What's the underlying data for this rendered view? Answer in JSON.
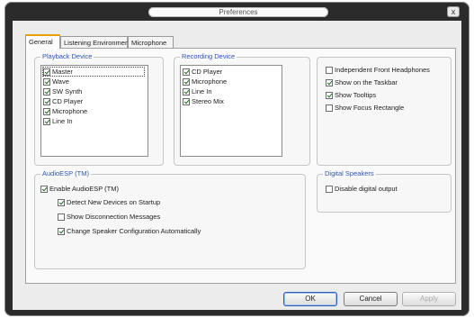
{
  "window": {
    "title": "Preferences",
    "close_glyph": "x"
  },
  "tabs": [
    {
      "label": "General",
      "active": true
    },
    {
      "label": "Listening Environment",
      "active": false
    },
    {
      "label": "Microphone",
      "active": false
    }
  ],
  "playback": {
    "title": "Playback Device",
    "items": [
      {
        "label": "Master",
        "checked": true
      },
      {
        "label": "Wave",
        "checked": true
      },
      {
        "label": "SW Synth",
        "checked": true
      },
      {
        "label": "CD Player",
        "checked": true
      },
      {
        "label": "Microphone",
        "checked": true
      },
      {
        "label": "Line In",
        "checked": true
      }
    ]
  },
  "recording": {
    "title": "Recording Device",
    "items": [
      {
        "label": "CD Player",
        "checked": true
      },
      {
        "label": "Microphone",
        "checked": true
      },
      {
        "label": "Line In",
        "checked": true
      },
      {
        "label": "Stereo Mix",
        "checked": true
      }
    ]
  },
  "options": [
    {
      "label": "Independent Front Headphones",
      "checked": false
    },
    {
      "label": "Show on the Taskbar",
      "checked": true
    },
    {
      "label": "Show Tooltips",
      "checked": true
    },
    {
      "label": "Show Focus Rectangle",
      "checked": false
    }
  ],
  "audioesp": {
    "title": "AudioESP (TM)",
    "enable": {
      "label": "Enable AudioESP (TM)",
      "checked": true
    },
    "sub": [
      {
        "label": "Detect New Devices on Startup",
        "checked": true
      },
      {
        "label": "Show Disconnection Messages",
        "checked": false
      },
      {
        "label": "Change Speaker Configuration Automatically",
        "checked": true
      }
    ]
  },
  "digital": {
    "title": "Digital Speakers",
    "disable": {
      "label": "Disable digital output",
      "checked": false
    }
  },
  "buttons": {
    "ok": "OK",
    "cancel": "Cancel",
    "apply": "Apply"
  }
}
